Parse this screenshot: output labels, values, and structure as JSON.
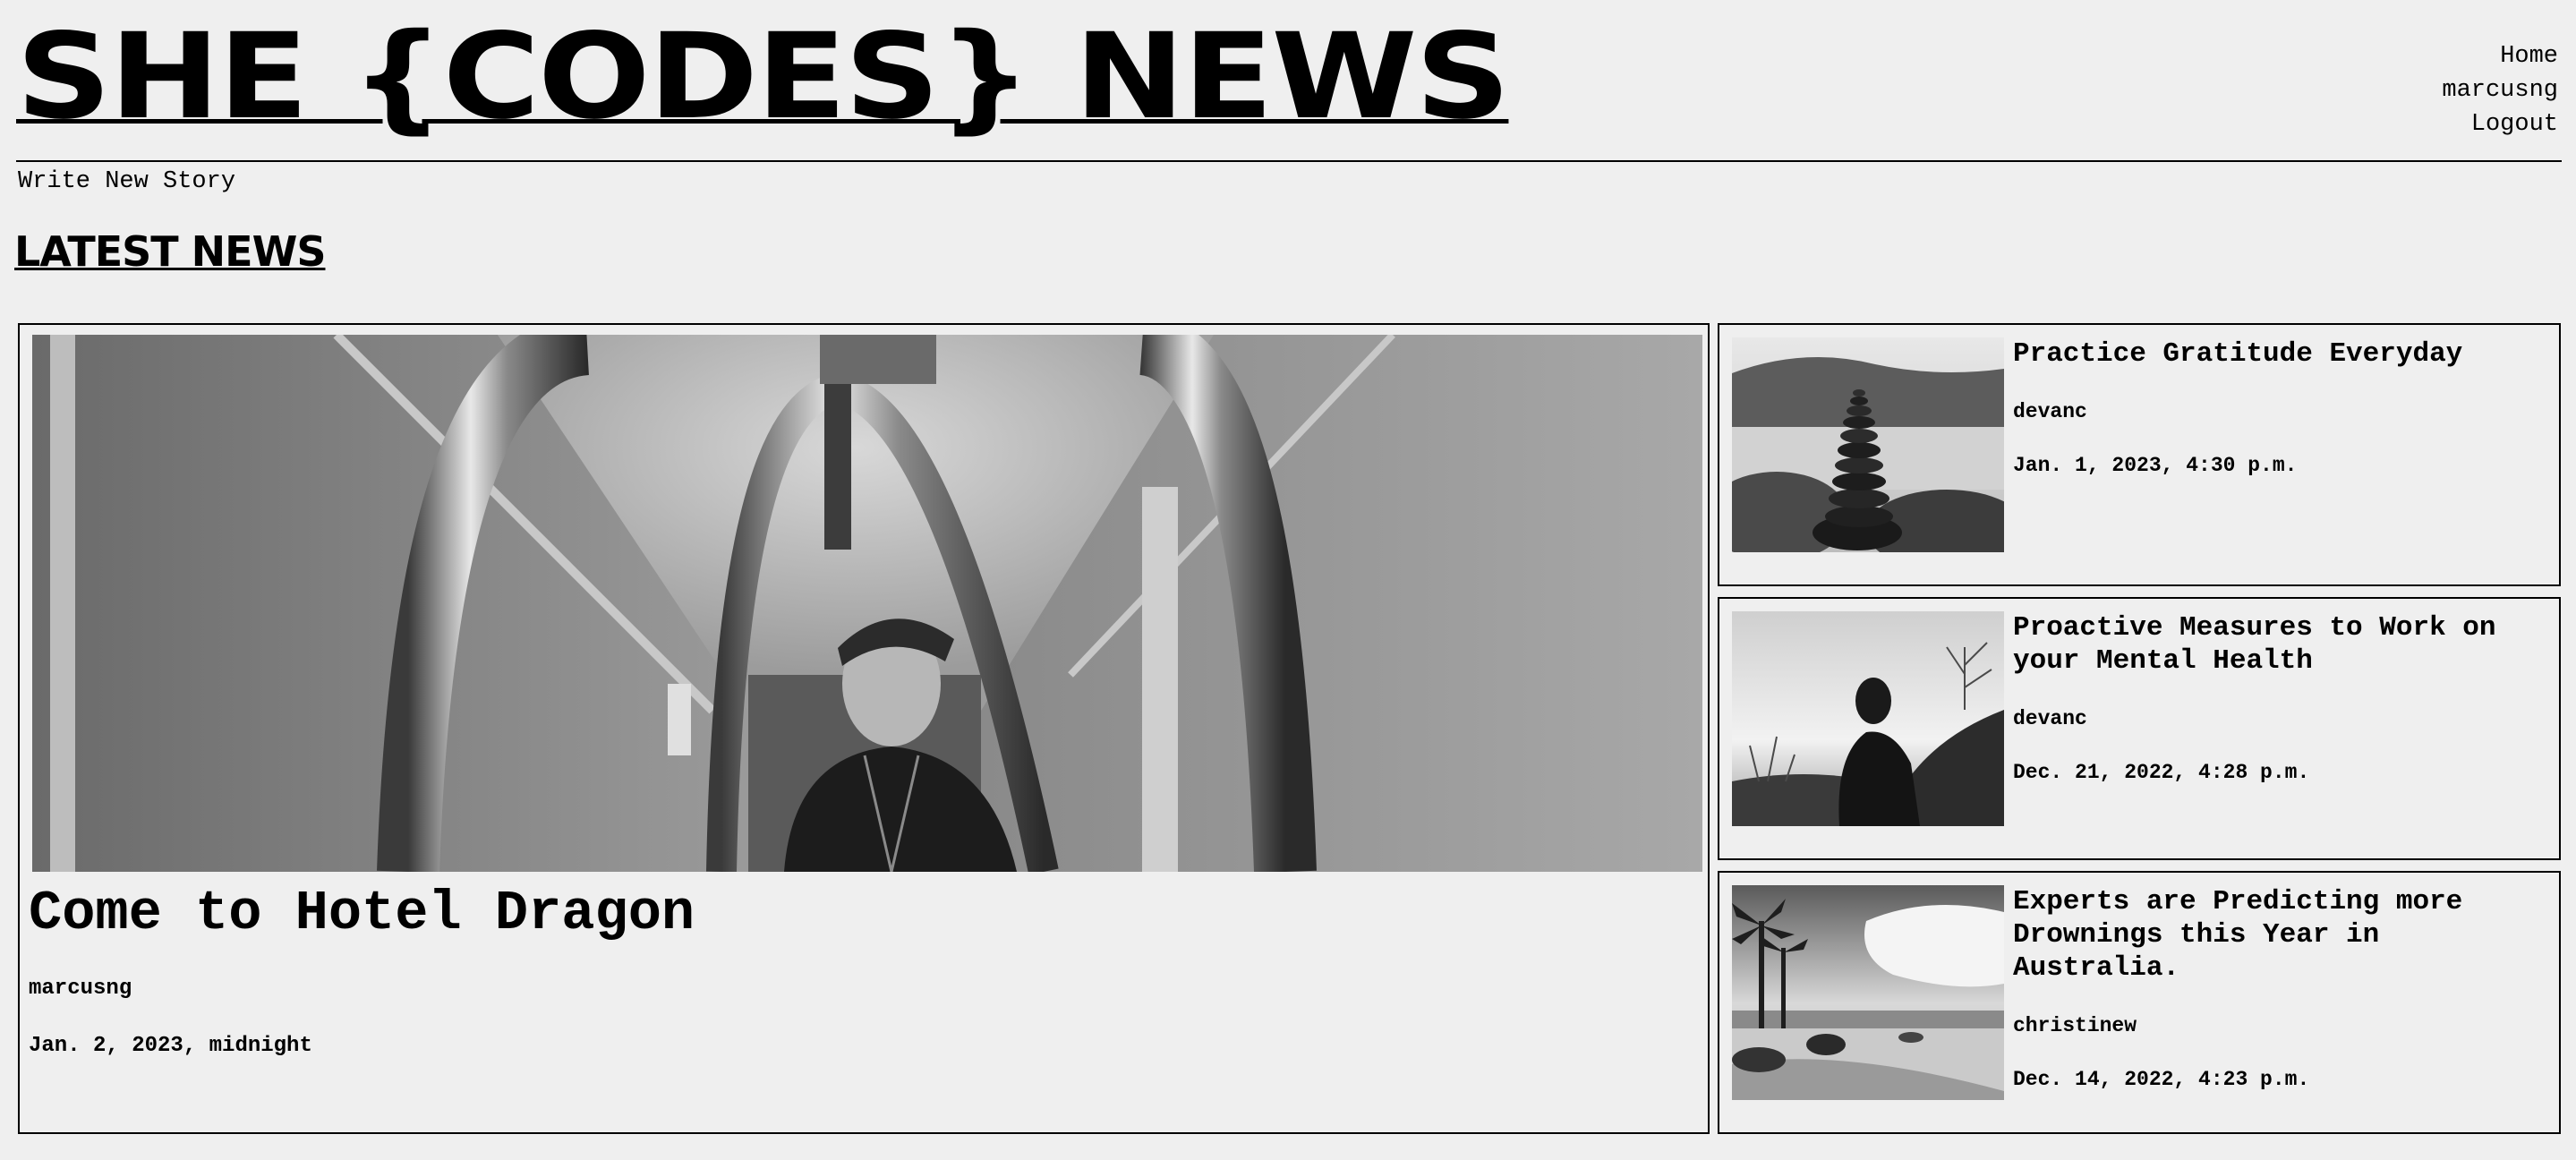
{
  "header": {
    "site_title": "SHE {CODES} NEWS",
    "nav": {
      "home": "Home",
      "user": "marcusng",
      "logout": "Logout"
    },
    "write_link": "Write New Story"
  },
  "main": {
    "section_title": "LATEST NEWS",
    "featured": {
      "title": "Come to Hotel Dragon",
      "author": "marcusng",
      "date": "Jan. 2, 2023, midnight",
      "image": "hotel-corridor-photo"
    },
    "stories": [
      {
        "title": "Practice Gratitude Everyday",
        "author": "devanc",
        "date": "Jan. 1, 2023, 4:30 p.m.",
        "image": "stacked-stones-photo"
      },
      {
        "title": "Proactive Measures to Work on your Mental Health",
        "author": "devanc",
        "date": "Dec. 21, 2022, 4:28 p.m.",
        "image": "silhouette-field-photo"
      },
      {
        "title": "Experts are Predicting more Drownings this Year in Australia.",
        "author": "christinew",
        "date": "Dec. 14, 2022, 4:23 p.m.",
        "image": "beach-shore-photo"
      }
    ]
  },
  "colors": {
    "background": "#efefef",
    "text": "#000000",
    "border": "#000000"
  }
}
